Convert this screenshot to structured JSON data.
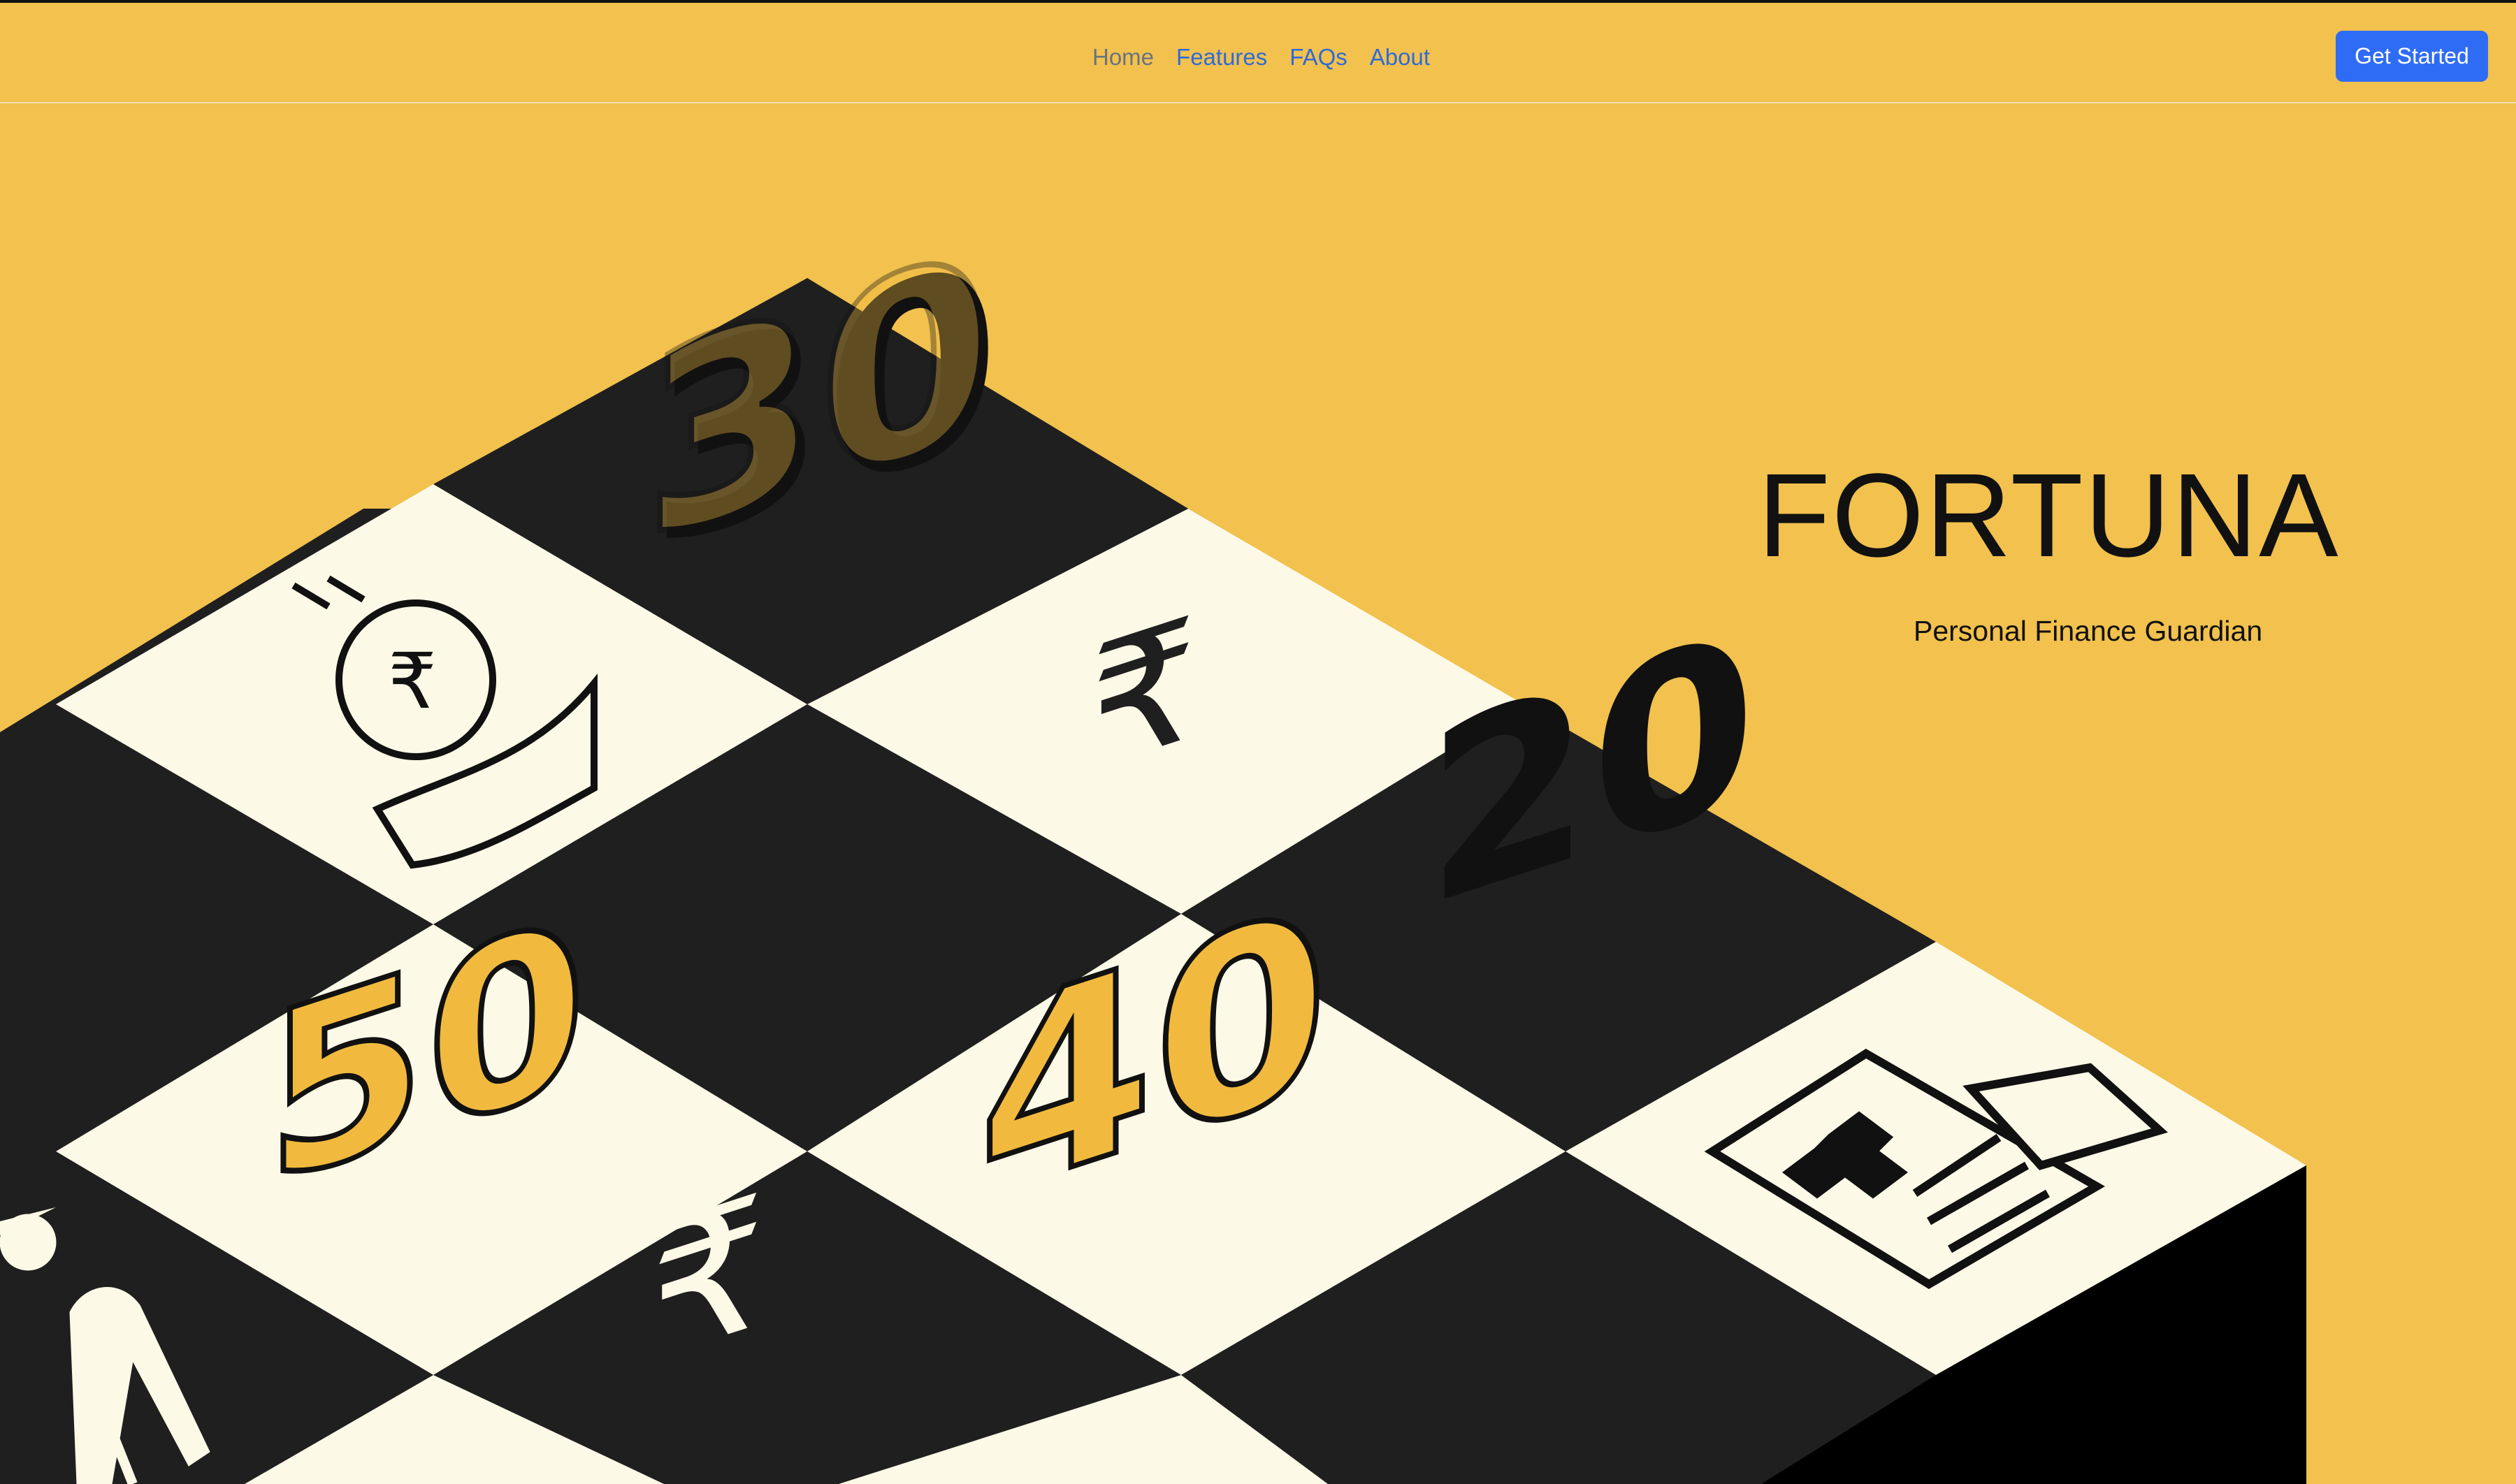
{
  "nav": {
    "links": [
      {
        "label": "Home"
      },
      {
        "label": "Features"
      },
      {
        "label": "FAQs"
      },
      {
        "label": "About"
      }
    ],
    "cta_label": "Get Started"
  },
  "hero": {
    "title": "FORTUNA",
    "subtitle": "Personal Finance Guardian",
    "illustration": {
      "numbers": [
        "30",
        "20",
        "50",
        "40"
      ],
      "icons": [
        "coin-in-hand-icon",
        "rupee-icon",
        "health-insurance-shield-icon",
        "elderly-person-icon"
      ]
    }
  },
  "colors": {
    "background": "#F2C14E",
    "board_dark": "#1F1F1F",
    "board_light": "#FDF9E7",
    "accent_blue": "#2F6CF5",
    "number_yellow": "#F1BA3E"
  }
}
